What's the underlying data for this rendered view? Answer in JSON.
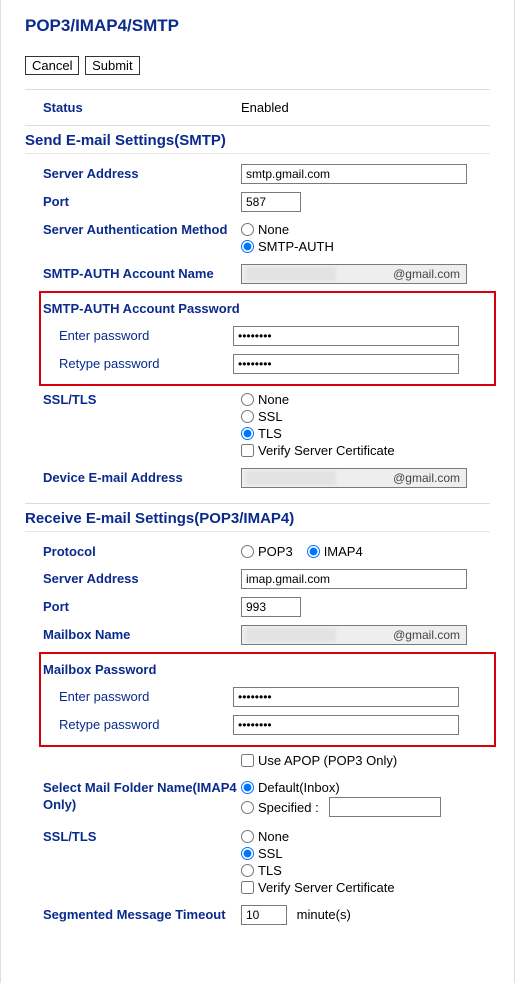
{
  "title": "POP3/IMAP4/SMTP",
  "buttons": {
    "cancel": "Cancel",
    "submit": "Submit"
  },
  "status": {
    "label": "Status",
    "value": "Enabled"
  },
  "smtp": {
    "section": "Send E-mail Settings(SMTP)",
    "server_label": "Server Address",
    "server_value": "smtp.gmail.com",
    "port_label": "Port",
    "port_value": "587",
    "auth_label": "Server Authentication Method",
    "auth_none": "None",
    "auth_smtp": "SMTP-AUTH",
    "account_label": "SMTP-AUTH Account Name",
    "account_suffix": "@gmail.com",
    "pwd_header": "SMTP-AUTH Account Password",
    "pwd_enter": "Enter password",
    "pwd_retype": "Retype password",
    "pwd_value": "••••••••",
    "ssl_label": "SSL/TLS",
    "ssl_none": "None",
    "ssl_ssl": "SSL",
    "ssl_tls": "TLS",
    "ssl_verify": "Verify Server Certificate",
    "device_label": "Device E-mail Address",
    "device_suffix": "@gmail.com"
  },
  "recv": {
    "section": "Receive E-mail Settings(POP3/IMAP4)",
    "protocol_label": "Protocol",
    "protocol_pop3": "POP3",
    "protocol_imap4": "IMAP4",
    "server_label": "Server Address",
    "server_value": "imap.gmail.com",
    "port_label": "Port",
    "port_value": "993",
    "mailbox_label": "Mailbox Name",
    "mailbox_suffix": "@gmail.com",
    "pwd_header": "Mailbox Password",
    "pwd_enter": "Enter password",
    "pwd_retype": "Retype password",
    "pwd_value": "••••••••",
    "apop": "Use APOP (POP3 Only)",
    "folder_label": "Select Mail Folder Name(IMAP4 Only)",
    "folder_default": "Default(Inbox)",
    "folder_specified": "Specified :",
    "ssl_label": "SSL/TLS",
    "ssl_none": "None",
    "ssl_ssl": "SSL",
    "ssl_tls": "TLS",
    "ssl_verify": "Verify Server Certificate",
    "timeout_label": "Segmented Message Timeout",
    "timeout_value": "10",
    "timeout_unit": "minute(s)"
  }
}
